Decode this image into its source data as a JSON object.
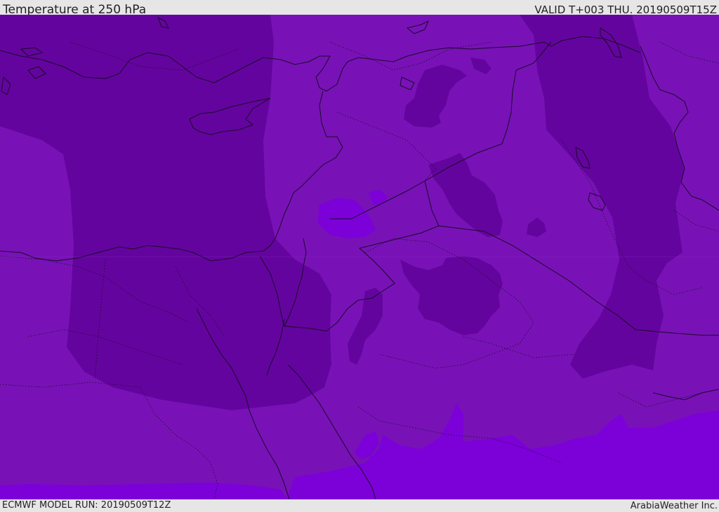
{
  "header": {
    "title": "Temperature at 250 hPa",
    "valid_time": "VALID T+003 THU. 20190509T15Z"
  },
  "footer": {
    "model_run": "ECMWF MODEL RUN: 20190509T12Z",
    "credit": "ArabiaWeather Inc."
  },
  "colors": {
    "base_field": "#7812b6",
    "cold_field": "#64049e",
    "warm_field": "#7c00d8",
    "outline": "#1a0a2a"
  }
}
